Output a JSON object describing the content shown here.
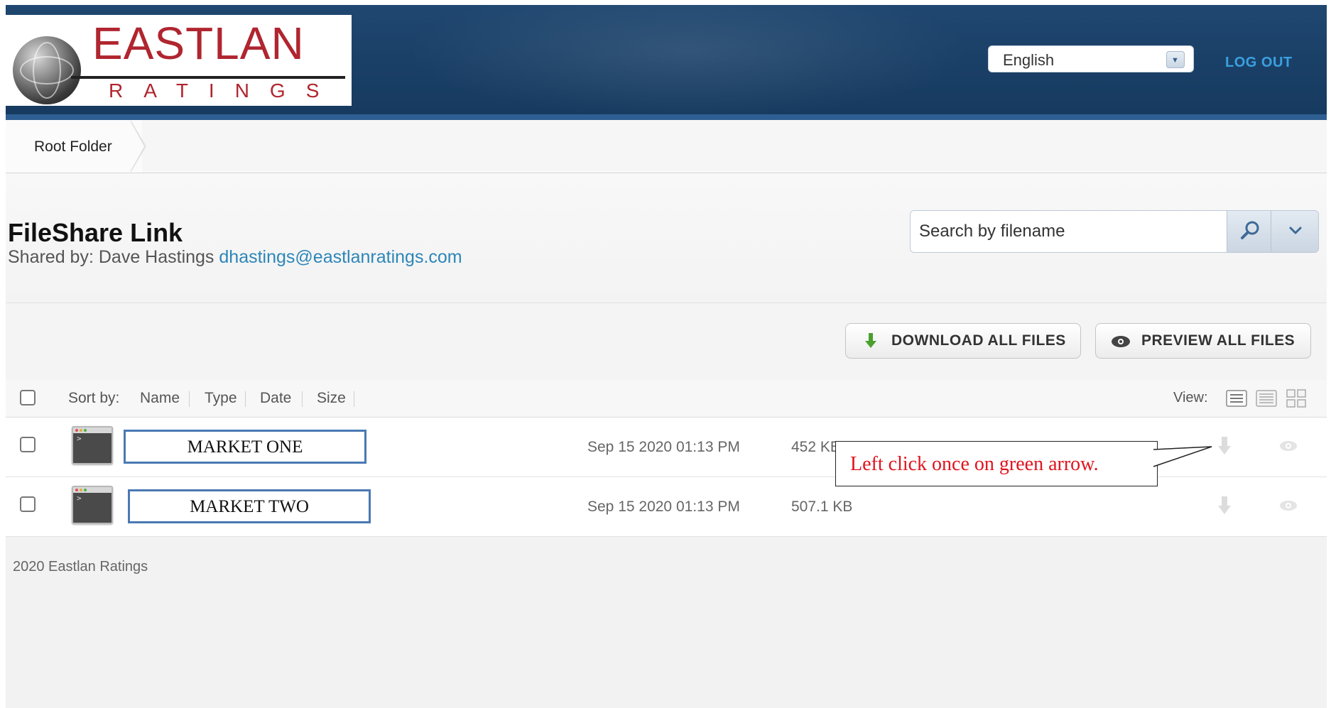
{
  "header": {
    "logo_word": "EASTLAN",
    "logo_sub": "RATINGS",
    "language": "English",
    "logout_label": "LOG OUT"
  },
  "breadcrumb": {
    "root": "Root Folder"
  },
  "title": {
    "heading": "FileShare Link",
    "shared_by_prefix": "Shared by: Dave Hastings",
    "email": "dhastings@eastlanratings.com"
  },
  "search": {
    "placeholder": "Search by filename"
  },
  "actions": {
    "download_all": "DOWNLOAD ALL FILES",
    "preview_all": "PREVIEW ALL FILES"
  },
  "list": {
    "sort_by_label": "Sort by:",
    "sort_options": [
      "Name",
      "Type",
      "Date",
      "Size"
    ],
    "view_label": "View:",
    "files": [
      {
        "name": "MARKET ONE",
        "date": "Sep 15 2020 01:13 PM",
        "size": "452 KB"
      },
      {
        "name": "MARKET TWO",
        "date": "Sep 15 2020 01:13 PM",
        "size": "507.1 KB"
      }
    ]
  },
  "callout": {
    "text": "Left click once on green arrow."
  },
  "footer": {
    "text": "2020 Eastlan Ratings"
  },
  "colors": {
    "header_bg": "#1a3f66",
    "logo_red": "#b0252f",
    "link_blue": "#2c86b8",
    "logout_blue": "#3aa1e0",
    "download_green": "#4aa02c",
    "callout_red": "#e0141e",
    "name_box_border": "#4a79b3"
  }
}
